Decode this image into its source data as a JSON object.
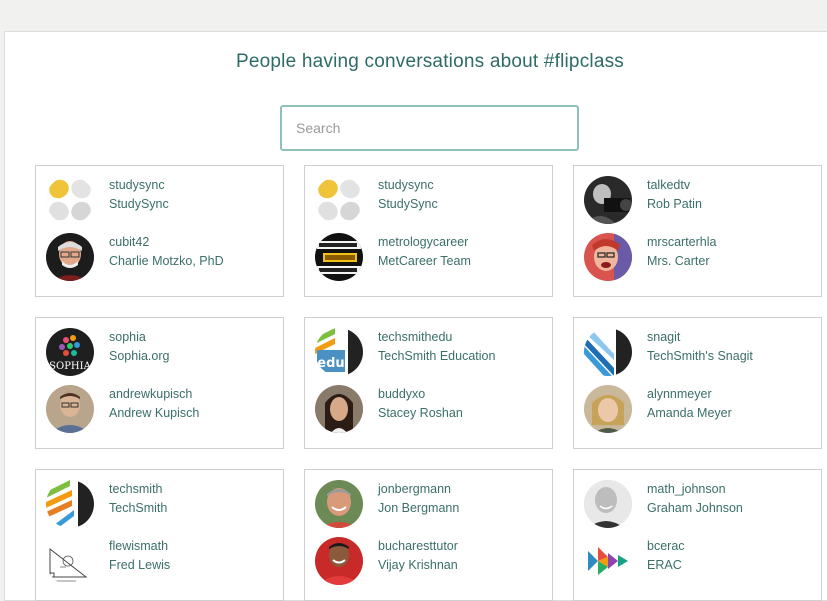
{
  "page": {
    "title": "People having conversations about #flipclass"
  },
  "search": {
    "placeholder": "Search"
  },
  "cards": [
    {
      "people": [
        {
          "handle": "studysync",
          "name": "StudySync",
          "avatar": "studysync-logo"
        },
        {
          "handle": "cubit42",
          "name": "Charlie Motzko, PhD",
          "avatar": "portrait-man-glasses"
        }
      ]
    },
    {
      "people": [
        {
          "handle": "studysync",
          "name": "StudySync",
          "avatar": "studysync-logo"
        },
        {
          "handle": "metrologycareer",
          "name": "MetCareer Team",
          "avatar": "metrology-logo"
        }
      ]
    },
    {
      "people": [
        {
          "handle": "talkedtv",
          "name": "Rob Patin",
          "avatar": "portrait-camera"
        },
        {
          "handle": "mrscarterhla",
          "name": "Mrs. Carter",
          "avatar": "portrait-woman-red"
        }
      ]
    },
    {
      "people": [
        {
          "handle": "sophia",
          "name": "Sophia.org",
          "avatar": "sophia-logo"
        },
        {
          "handle": "andrewkupisch",
          "name": "Andrew Kupisch",
          "avatar": "portrait-man"
        }
      ]
    },
    {
      "people": [
        {
          "handle": "techsmithedu",
          "name": "TechSmith Education",
          "avatar": "techsmith-edu-logo"
        },
        {
          "handle": "buddyxo",
          "name": "Stacey Roshan",
          "avatar": "portrait-woman-dark"
        }
      ]
    },
    {
      "people": [
        {
          "handle": "snagit",
          "name": "TechSmith's Snagit",
          "avatar": "snagit-logo"
        },
        {
          "handle": "alynnmeyer",
          "name": "Amanda Meyer",
          "avatar": "portrait-woman-blonde"
        }
      ]
    },
    {
      "people": [
        {
          "handle": "techsmith",
          "name": "TechSmith",
          "avatar": "techsmith-logo"
        },
        {
          "handle": "flewismath",
          "name": "Fred Lewis",
          "avatar": "math-sketch"
        }
      ]
    },
    {
      "people": [
        {
          "handle": "jonbergmann",
          "name": "Jon Bergmann",
          "avatar": "portrait-man-smile"
        },
        {
          "handle": "bucharesttutor",
          "name": "Vijay Krishnan",
          "avatar": "portrait-man-red"
        }
      ]
    },
    {
      "people": [
        {
          "handle": "math_johnson",
          "name": "Graham Johnson",
          "avatar": "portrait-bald-bw"
        },
        {
          "handle": "bcerac",
          "name": "ERAC",
          "avatar": "erac-logo"
        }
      ]
    }
  ],
  "logo_text": {
    "sophia": "SOPHIA",
    "edu": "edu",
    "techsmith": "TechSmith"
  },
  "colors": {
    "accent": "#2d6b66",
    "search_border": "#8fc0b9",
    "card_border": "#cfcfcf"
  }
}
